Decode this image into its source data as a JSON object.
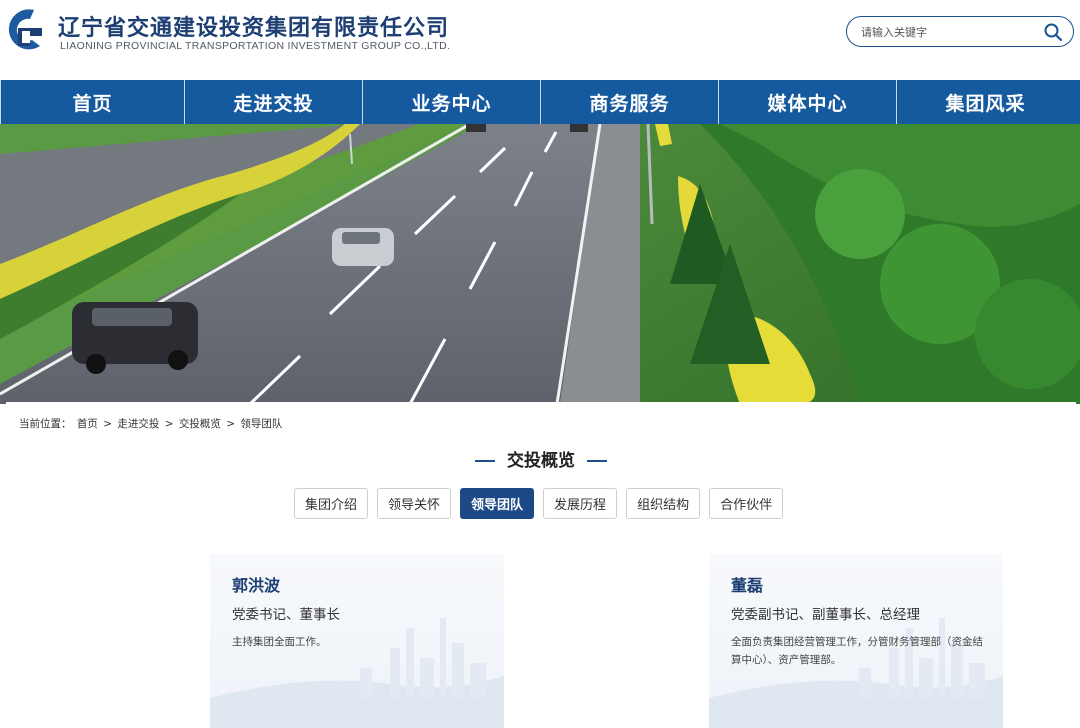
{
  "header": {
    "company_cn": "辽宁省交通建设投资集团有限责任公司",
    "company_en": "LIAONING PROVINCIAL TRANSPORTATION INVESTMENT GROUP CO.,LTD.",
    "search_placeholder": "请输入关键字",
    "search_icon": "search-icon"
  },
  "nav": {
    "items": [
      "首页",
      "走进交投",
      "业务中心",
      "商务服务",
      "媒体中心",
      "集团风采"
    ]
  },
  "breadcrumb": {
    "prefix": "当前位置：",
    "items": [
      "首页",
      "走进交投",
      "交投概览",
      "领导团队"
    ],
    "separator": ">"
  },
  "section": {
    "title": "交投概览"
  },
  "tabs": {
    "items": [
      "集团介绍",
      "领导关怀",
      "领导团队",
      "发展历程",
      "组织结构",
      "合作伙伴"
    ],
    "active": "领导团队"
  },
  "leaders": [
    {
      "name": "郭洪波",
      "title": "党委书记、董事长",
      "desc": "主持集团全面工作。"
    },
    {
      "name": "董磊",
      "title": "党委副书记、副董事长、总经理",
      "desc": "全面负责集团经营管理工作，分管财务管理部（资金结算中心）、资产管理部。"
    }
  ],
  "colors": {
    "nav_bg": "#15599e",
    "brand_text": "#1d3f73",
    "active_tab": "#1d4a86"
  }
}
